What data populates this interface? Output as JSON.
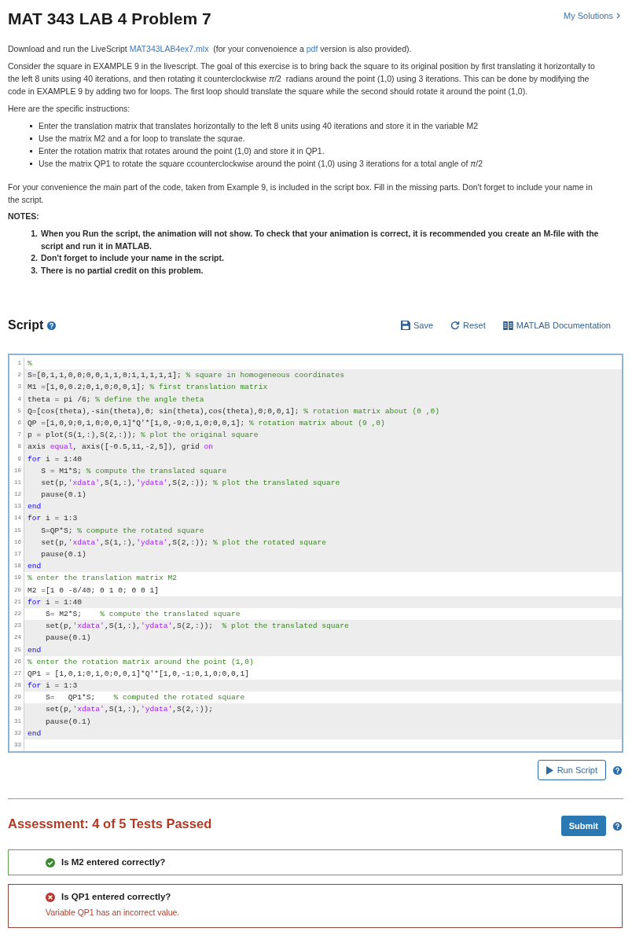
{
  "header": {
    "title": "MAT 343 LAB 4 Problem 7",
    "solutions_link": "My Solutions"
  },
  "intro": [
    {
      "parts": [
        {
          "kind": "text",
          "text": "Download and run the LiveScript "
        },
        {
          "kind": "link",
          "text": "MAT343LAB4ex7.mlx"
        },
        {
          "kind": "text",
          "text": "  (for your convenoience a "
        },
        {
          "kind": "link",
          "text": "pdf"
        },
        {
          "kind": "text",
          "text": " version is also provided)."
        }
      ]
    },
    {
      "parts": [
        {
          "kind": "text",
          "text": "Consider the square in EXAMPLE 9 in the livescript. The goal of this exercise is to bring back the square to its original position by first translating it horizontally to the left 8 units using 40 iterations, and then rotating it counterclockwise *π*/2  radians around the point (1,0) using 3 iterations. This can be done by modifying the code in EXAMPLE 9 by adding two for loops. The first loop should translate the square while the second should rotate it around the point (1,0)."
        }
      ]
    },
    {
      "parts": [
        {
          "kind": "text",
          "text": "Here are the specific instructions:"
        }
      ]
    }
  ],
  "instructions": [
    "Enter the translation matrix that translates horizontally to the left 8 units using 40 iterations and store it in the variable M2",
    "Use the matrix M2 and a for loop to translate the squrae.",
    "Enter the rotation matrix that rotates around the point (1,0) and store it in QP1.",
    "Use the matrix QP1 to rotate the square ccounterclockwise around the point (1,0) using 3 iterations for a total angle of *π*/2"
  ],
  "closing": "For your convenience the main part of the code, taken from Example 9, is included in the script box. Fill in the missing parts. Don't forget to include your name in the script.",
  "notes": {
    "heading": "NOTES:",
    "items": [
      {
        "marker": "1.",
        "text": "When you Run the script, the animation will not show. To check that your animation is correct, it is recommended you create an M-file with the script and run it in MATLAB."
      },
      {
        "marker": "2.",
        "text": "Don't forget to include your name in the script."
      },
      {
        "marker": "3.",
        "text": "There is no partial credit on this problem."
      }
    ]
  },
  "script": {
    "title": "Script",
    "actions": [
      {
        "kind": "save",
        "label": "Save"
      },
      {
        "kind": "reset",
        "label": "Reset"
      },
      {
        "kind": "docs",
        "label": "MATLAB Documentation"
      }
    ],
    "lines": [
      {
        "number": "1",
        "locked": false,
        "tokens": [
          {
            "kind": "comment",
            "text": "%"
          }
        ]
      },
      {
        "number": "2",
        "locked": true,
        "tokens": [
          {
            "kind": "code",
            "text": "S=[0,1,1,0,0;0,0,1,1,0;1,1,1,1,1]; "
          },
          {
            "kind": "comment",
            "text": "% square in homogeneous coordinates"
          }
        ]
      },
      {
        "number": "3",
        "locked": true,
        "tokens": [
          {
            "kind": "code",
            "text": "M1 =[1,0,0.2;0,1,0;0,0,1]; "
          },
          {
            "kind": "comment",
            "text": "% first translation matrix"
          }
        ]
      },
      {
        "number": "4",
        "locked": true,
        "tokens": [
          {
            "kind": "code",
            "text": "theta = pi /6; "
          },
          {
            "kind": "comment",
            "text": "% define the angle theta"
          }
        ]
      },
      {
        "number": "5",
        "locked": true,
        "tokens": [
          {
            "kind": "code",
            "text": "Q=[cos(theta),-sin(theta),0; sin(theta),cos(theta),0;0,0,1]; "
          },
          {
            "kind": "comment",
            "text": "% rotation matrix about (0 ,0)"
          }
        ]
      },
      {
        "number": "6",
        "locked": true,
        "tokens": [
          {
            "kind": "code",
            "text": "QP =[1,0,9;0,1,0;0,0,1]*Q'*[1,0,-9;0,1,0;0,0,1]; "
          },
          {
            "kind": "comment",
            "text": "% rotation matrix about (9 ,0)"
          }
        ]
      },
      {
        "number": "7",
        "locked": true,
        "tokens": [
          {
            "kind": "code",
            "text": "p = plot(S(1,:),S(2,:)); "
          },
          {
            "kind": "comment",
            "text": "% plot the original square"
          }
        ]
      },
      {
        "number": "8",
        "locked": true,
        "tokens": [
          {
            "kind": "code",
            "text": "axis "
          },
          {
            "kind": "string",
            "text": "equal"
          },
          {
            "kind": "code",
            "text": ", axis([-0.5,11,-2,5]), grid "
          },
          {
            "kind": "string",
            "text": "on"
          }
        ]
      },
      {
        "number": "9",
        "locked": true,
        "tokens": [
          {
            "kind": "keyword",
            "text": "for"
          },
          {
            "kind": "code",
            "text": " i = 1:40"
          }
        ]
      },
      {
        "number": "10",
        "locked": true,
        "tokens": [
          {
            "kind": "code",
            "text": "   S = M1*S; "
          },
          {
            "kind": "comment",
            "text": "% compute the translated square"
          }
        ]
      },
      {
        "number": "11",
        "locked": true,
        "tokens": [
          {
            "kind": "code",
            "text": "   set(p,"
          },
          {
            "kind": "string",
            "text": "'xdata'"
          },
          {
            "kind": "code",
            "text": ",S(1,:),"
          },
          {
            "kind": "string",
            "text": "'ydata'"
          },
          {
            "kind": "code",
            "text": ",S(2,:)); "
          },
          {
            "kind": "comment",
            "text": "% plot the translated square"
          }
        ]
      },
      {
        "number": "12",
        "locked": true,
        "tokens": [
          {
            "kind": "code",
            "text": "   pause(0.1)"
          }
        ]
      },
      {
        "number": "13",
        "locked": true,
        "tokens": [
          {
            "kind": "keyword",
            "text": "end"
          }
        ]
      },
      {
        "number": "14",
        "locked": true,
        "tokens": [
          {
            "kind": "keyword",
            "text": "for"
          },
          {
            "kind": "code",
            "text": " i = 1:3"
          }
        ]
      },
      {
        "number": "15",
        "locked": true,
        "tokens": [
          {
            "kind": "code",
            "text": "   S=QP*S; "
          },
          {
            "kind": "comment",
            "text": "% compute the rotated square"
          }
        ]
      },
      {
        "number": "16",
        "locked": true,
        "tokens": [
          {
            "kind": "code",
            "text": "   set(p,"
          },
          {
            "kind": "string",
            "text": "'xdata'"
          },
          {
            "kind": "code",
            "text": ",S(1,:),"
          },
          {
            "kind": "string",
            "text": "'ydata'"
          },
          {
            "kind": "code",
            "text": ",S(2,:)); "
          },
          {
            "kind": "comment",
            "text": "% plot the rotated square"
          }
        ]
      },
      {
        "number": "17",
        "locked": true,
        "tokens": [
          {
            "kind": "code",
            "text": "   pause(0.1)"
          }
        ]
      },
      {
        "number": "18",
        "locked": true,
        "tokens": [
          {
            "kind": "keyword",
            "text": "end"
          }
        ]
      },
      {
        "number": "19",
        "locked": false,
        "tokens": [
          {
            "kind": "comment",
            "text": "% enter the translation matrix M2"
          }
        ]
      },
      {
        "number": "20",
        "locked": false,
        "tokens": [
          {
            "kind": "code",
            "text": "M2 =[1 0 -8/40; 0 1 0; 0 0 1]"
          }
        ]
      },
      {
        "number": "21",
        "locked": true,
        "tokens": [
          {
            "kind": "keyword",
            "text": "for"
          },
          {
            "kind": "code",
            "text": " i = 1:40"
          }
        ]
      },
      {
        "number": "22",
        "locked": false,
        "tokens": [
          {
            "kind": "code",
            "text": "    S= M2*S;    "
          },
          {
            "kind": "comment",
            "text": "% compute the translated square"
          }
        ]
      },
      {
        "number": "23",
        "locked": true,
        "tokens": [
          {
            "kind": "code",
            "text": "    set(p,"
          },
          {
            "kind": "string",
            "text": "'xdata'"
          },
          {
            "kind": "code",
            "text": ",S(1,:),"
          },
          {
            "kind": "string",
            "text": "'ydata'"
          },
          {
            "kind": "code",
            "text": ",S(2,:));  "
          },
          {
            "kind": "comment",
            "text": "% plot the translated square"
          }
        ]
      },
      {
        "number": "24",
        "locked": true,
        "tokens": [
          {
            "kind": "code",
            "text": "    pause(0.1)"
          }
        ]
      },
      {
        "number": "25",
        "locked": true,
        "tokens": [
          {
            "kind": "keyword",
            "text": "end"
          }
        ]
      },
      {
        "number": "26",
        "locked": false,
        "tokens": [
          {
            "kind": "comment",
            "text": "% enter the rotation matrix around the point (1,0)"
          }
        ]
      },
      {
        "number": "27",
        "locked": false,
        "tokens": [
          {
            "kind": "code",
            "text": "QP1 = [1,0,1;0,1,0;0,0,1]*Q'*[1,0,-1;0,1,0;0,0,1]"
          }
        ]
      },
      {
        "number": "28",
        "locked": true,
        "tokens": [
          {
            "kind": "keyword",
            "text": "for"
          },
          {
            "kind": "code",
            "text": " i = 1:3"
          }
        ]
      },
      {
        "number": "29",
        "locked": false,
        "tokens": [
          {
            "kind": "code",
            "text": "    S=   QP1*S;    "
          },
          {
            "kind": "comment",
            "text": "% computed the rotated square"
          }
        ]
      },
      {
        "number": "30",
        "locked": true,
        "tokens": [
          {
            "kind": "code",
            "text": "    set(p,"
          },
          {
            "kind": "string",
            "text": "'xdata'"
          },
          {
            "kind": "code",
            "text": ",S(1,:),"
          },
          {
            "kind": "string",
            "text": "'ydata'"
          },
          {
            "kind": "code",
            "text": ",S(2,:));"
          }
        ]
      },
      {
        "number": "31",
        "locked": true,
        "tokens": [
          {
            "kind": "code",
            "text": "    pause(0.1)"
          }
        ]
      },
      {
        "number": "32",
        "locked": true,
        "tokens": [
          {
            "kind": "keyword",
            "text": "end"
          }
        ]
      },
      {
        "number": "33",
        "locked": false
      }
    ],
    "run_button": "Run Script"
  },
  "assessment": {
    "title": "Assessment: 4 of 5 Tests Passed",
    "submit": "Submit",
    "tests": [
      {
        "passed": true,
        "title": "Is M2 entered correctly?"
      },
      {
        "passed": false,
        "title": "Is QP1 entered correctly?",
        "message": "Variable QP1 has an incorrect value."
      }
    ]
  }
}
